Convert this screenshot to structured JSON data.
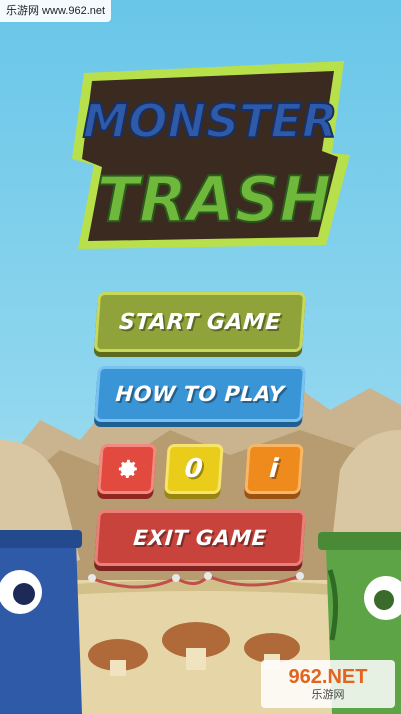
{
  "watermark": {
    "top": "乐游网 www.962.net",
    "brand": "962.NET",
    "sub": "乐游网"
  },
  "logo": {
    "line1": "MONSTER",
    "line2": "TRASH"
  },
  "menu": {
    "start": "START GAME",
    "howto": "HOW TO PLAY",
    "settings_icon": "gear-icon",
    "score": "0",
    "info": "i",
    "exit": "EXIT GAME"
  },
  "colors": {
    "sky": "#69c6e8",
    "start": "#8fa33a",
    "howto": "#3a95d6",
    "settings": "#e2493f",
    "score": "#eacc1b",
    "info": "#ef8a1d",
    "exit": "#c8433c"
  }
}
